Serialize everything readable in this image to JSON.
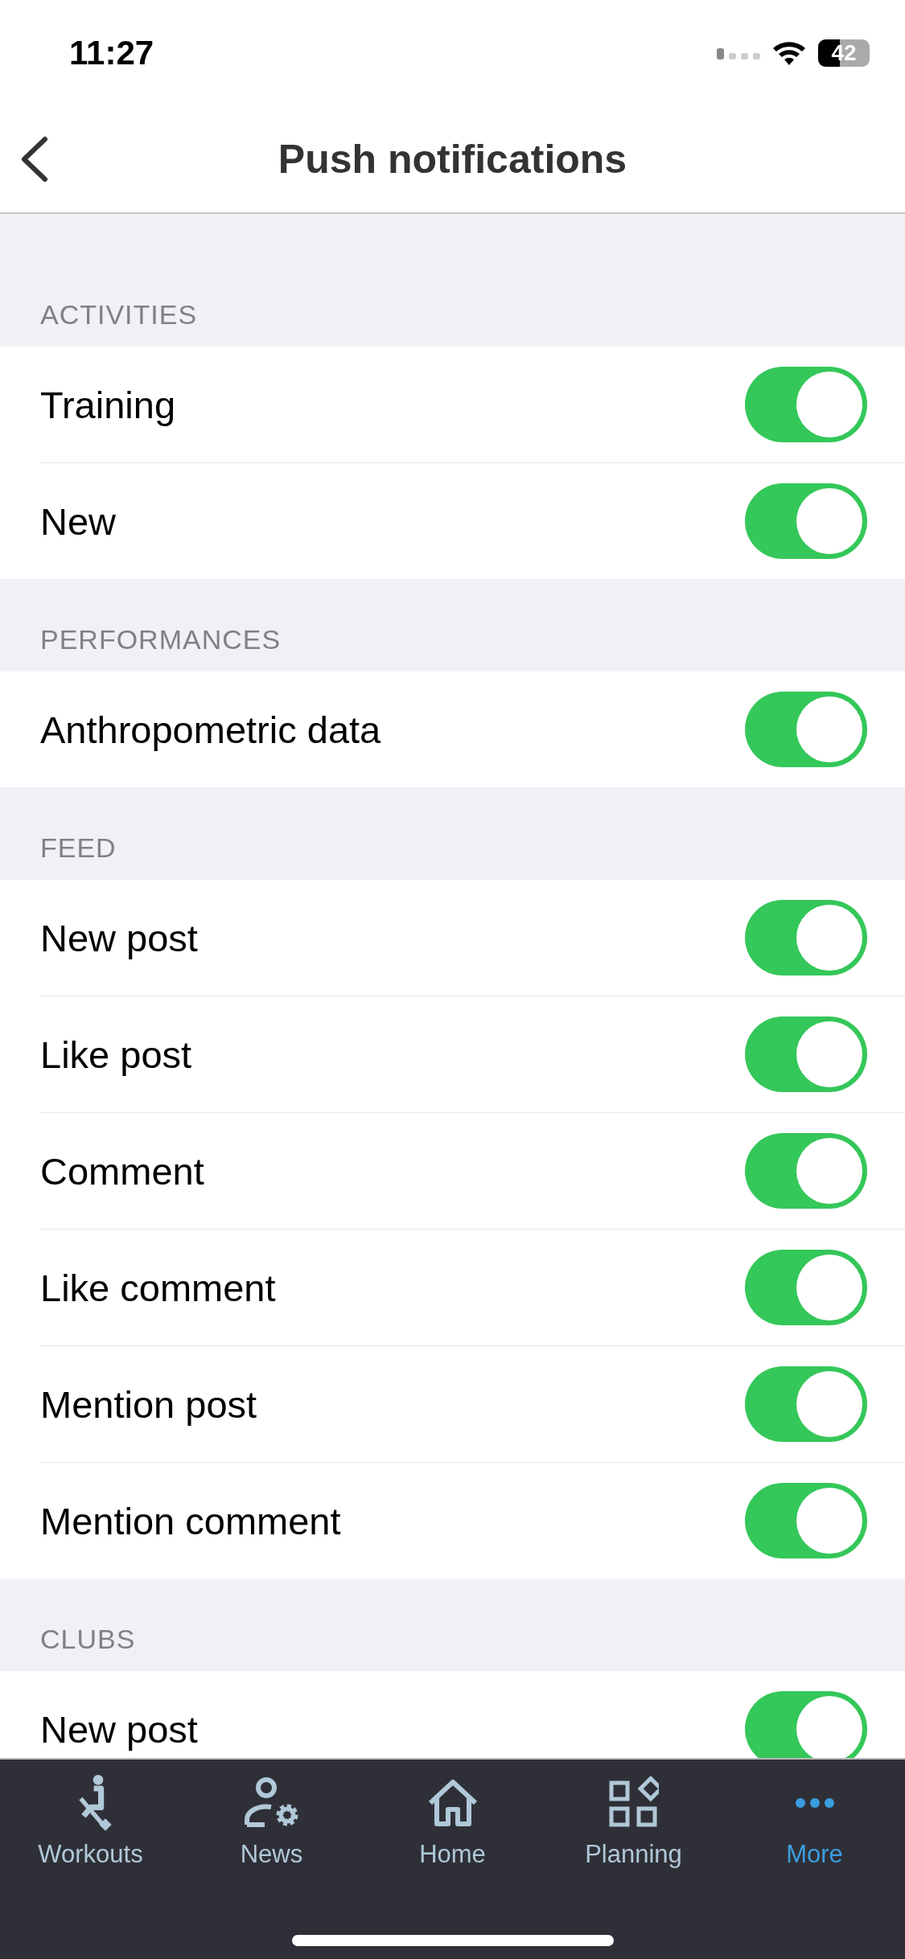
{
  "status_bar": {
    "time": "11:27",
    "battery": "42"
  },
  "nav": {
    "title": "Push notifications"
  },
  "sections": [
    {
      "header": "ACTIVITIES",
      "rows": [
        {
          "label": "Training",
          "on": true
        },
        {
          "label": "New",
          "on": true
        }
      ]
    },
    {
      "header": "PERFORMANCES",
      "rows": [
        {
          "label": "Anthropometric data",
          "on": true
        }
      ]
    },
    {
      "header": "FEED",
      "rows": [
        {
          "label": "New post",
          "on": true
        },
        {
          "label": "Like post",
          "on": true
        },
        {
          "label": "Comment",
          "on": true
        },
        {
          "label": "Like comment",
          "on": true
        },
        {
          "label": "Mention post",
          "on": true
        },
        {
          "label": "Mention comment",
          "on": true
        }
      ]
    },
    {
      "header": "CLUBS",
      "rows": [
        {
          "label": "New post",
          "on": true
        }
      ]
    }
  ],
  "tab_bar": [
    {
      "kind": "workouts",
      "label": "Workouts",
      "selected": false
    },
    {
      "kind": "news",
      "label": "News",
      "selected": false
    },
    {
      "kind": "home",
      "label": "Home",
      "selected": false
    },
    {
      "kind": "planning",
      "label": "Planning",
      "selected": false
    },
    {
      "kind": "more",
      "label": "More",
      "selected": true
    }
  ]
}
